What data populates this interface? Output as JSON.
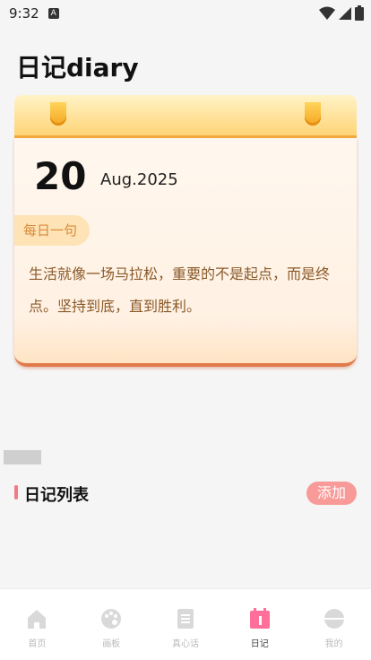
{
  "status_bar": {
    "time": "9:32",
    "notification_letter": "A"
  },
  "title": "日记diary",
  "card": {
    "day": "20",
    "month_year": "Aug.2025",
    "quote_tag": "每日一句",
    "quote": "生活就像一场马拉松，重要的不是起点，而是终点。坚持到底，直到胜利。"
  },
  "diary_list": {
    "title": "日记列表",
    "add_label": "添加"
  },
  "nav": {
    "items": [
      {
        "label": "首页",
        "icon": "home-icon"
      },
      {
        "label": "画板",
        "icon": "palette-icon"
      },
      {
        "label": "真心话",
        "icon": "document-icon"
      },
      {
        "label": "日记",
        "icon": "calendar-icon",
        "active": true
      },
      {
        "label": "我的",
        "icon": "profile-icon"
      }
    ]
  },
  "colors": {
    "accent": "#f07a85",
    "nav_active": "#ff6f9a",
    "nav_inactive": "#d9d9d9"
  }
}
